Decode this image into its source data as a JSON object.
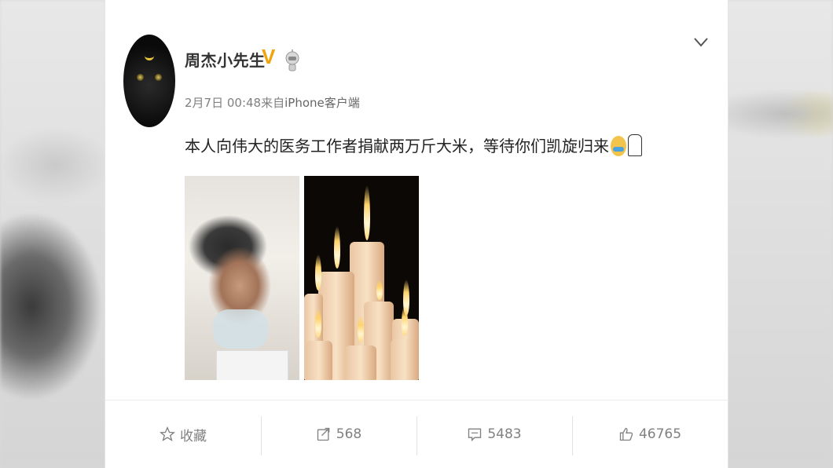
{
  "post": {
    "username": "周杰小先生",
    "verified_badge": "V",
    "timestamp": "2月7日 00:48",
    "source_prefix": "来自",
    "source": "iPhone客户端",
    "text": "本人向伟大的医务工作者捐献两万斤大米，等待你们凯旋归来",
    "emojis": [
      "crying-face-icon",
      "candle-icon"
    ],
    "menu_icon": "chevron-down-icon"
  },
  "actions": {
    "favorite": {
      "label": "收藏",
      "icon": "star-icon"
    },
    "repost": {
      "count": "568",
      "icon": "share-icon"
    },
    "comment": {
      "count": "5483",
      "icon": "comment-icon"
    },
    "like": {
      "count": "46765",
      "icon": "thumbs-up-icon"
    }
  },
  "colors": {
    "verified": "#f2a20a",
    "text": "#222222",
    "meta": "#808080"
  }
}
